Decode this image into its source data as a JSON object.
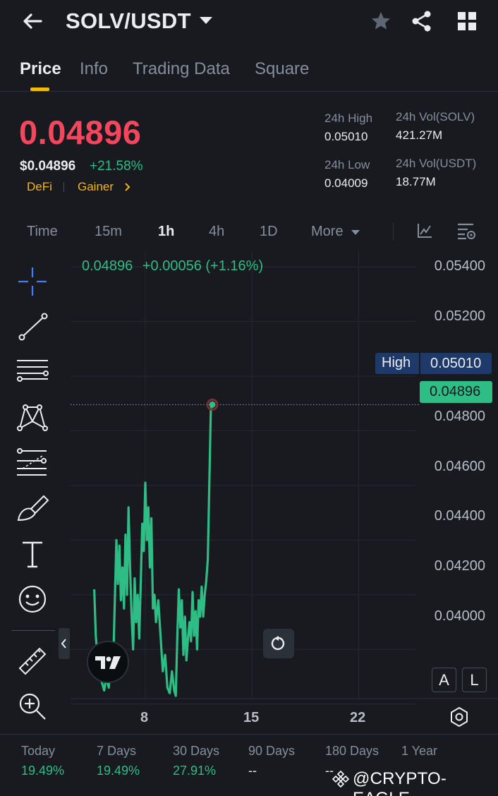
{
  "header": {
    "pair": "SOLV/USDT"
  },
  "tabs": [
    {
      "label": "Price"
    },
    {
      "label": "Info"
    },
    {
      "label": "Trading Data"
    },
    {
      "label": "Square"
    }
  ],
  "ticker": {
    "last_price": "0.04896",
    "usd_price": "$0.04896",
    "change_pct": "+21.58%",
    "tag_category": "DeFi",
    "tag_gainer": "Gainer",
    "high_label": "24h High",
    "high_value": "0.05010",
    "low_label": "24h Low",
    "low_value": "0.04009",
    "vol_base_label": "24h Vol(SOLV)",
    "vol_base_value": "421.27M",
    "vol_quote_label": "24h Vol(USDT)",
    "vol_quote_value": "18.77M"
  },
  "intervals": {
    "time": "Time",
    "m15": "15m",
    "h1": "1h",
    "h4": "4h",
    "d1": "1D",
    "more": "More"
  },
  "chart": {
    "legend_price": "0.04896",
    "legend_change": "+0.00056 (+1.16%)",
    "high_tag_label": "High",
    "high_tag_value": "0.05010",
    "current_tag_value": "0.04896",
    "y_ticks": [
      "0.05400",
      "0.05200",
      "0.04800",
      "0.04600",
      "0.04400",
      "0.04200",
      "0.04000"
    ],
    "x_ticks": [
      "8",
      "15",
      "22"
    ],
    "btn_auto": "A",
    "btn_log": "L",
    "line_color": "#2ebd85",
    "price_color": "#f6465d"
  },
  "chart_data": {
    "type": "line",
    "x_axis": "day of month",
    "y_axis": "price (USDT)",
    "ylim": [
      0.0382,
      0.0546
    ],
    "x_ticks": [
      8,
      15,
      22
    ],
    "series": [
      {
        "points": [
          [
            4.65,
            0.0422
          ],
          [
            4.75,
            0.0405
          ],
          [
            4.85,
            0.0398
          ],
          [
            5.0,
            0.0392
          ],
          [
            5.15,
            0.0388
          ],
          [
            5.3,
            0.0385
          ],
          [
            5.45,
            0.039
          ],
          [
            5.6,
            0.0386
          ],
          [
            5.75,
            0.04
          ],
          [
            5.9,
            0.0396
          ],
          [
            6.0,
            0.0418
          ],
          [
            6.1,
            0.044
          ],
          [
            6.2,
            0.0424
          ],
          [
            6.3,
            0.0438
          ],
          [
            6.4,
            0.0418
          ],
          [
            6.5,
            0.043
          ],
          [
            6.6,
            0.0415
          ],
          [
            6.7,
            0.0442
          ],
          [
            6.8,
            0.042
          ],
          [
            6.9,
            0.0452
          ],
          [
            7.0,
            0.043
          ],
          [
            7.1,
            0.0412
          ],
          [
            7.2,
            0.04
          ],
          [
            7.3,
            0.0426
          ],
          [
            7.4,
            0.041
          ],
          [
            7.5,
            0.042
          ],
          [
            7.6,
            0.0404
          ],
          [
            7.7,
            0.0424
          ],
          [
            7.8,
            0.0446
          ],
          [
            7.9,
            0.0436
          ],
          [
            8.0,
            0.0461
          ],
          [
            8.1,
            0.044
          ],
          [
            8.2,
            0.0452
          ],
          [
            8.3,
            0.043
          ],
          [
            8.4,
            0.0448
          ],
          [
            8.5,
            0.0415
          ],
          [
            8.6,
            0.042
          ],
          [
            8.7,
            0.041
          ],
          [
            8.85,
            0.0418
          ],
          [
            9.0,
            0.0405
          ],
          [
            9.15,
            0.0392
          ],
          [
            9.3,
            0.0398
          ],
          [
            9.45,
            0.0386
          ],
          [
            9.6,
            0.0384
          ],
          [
            9.75,
            0.0392
          ],
          [
            9.9,
            0.0385
          ],
          [
            10.0,
            0.0383
          ],
          [
            10.1,
            0.0405
          ],
          [
            10.2,
            0.0422
          ],
          [
            10.3,
            0.0408
          ],
          [
            10.4,
            0.0418
          ],
          [
            10.5,
            0.0398
          ],
          [
            10.6,
            0.0412
          ],
          [
            10.7,
            0.0396
          ],
          [
            10.8,
            0.0404
          ],
          [
            10.9,
            0.041
          ],
          [
            11.0,
            0.0403
          ],
          [
            11.1,
            0.0421
          ],
          [
            11.2,
            0.0405
          ],
          [
            11.3,
            0.0414
          ],
          [
            11.4,
            0.04
          ],
          [
            11.5,
            0.0418
          ],
          [
            11.6,
            0.0412
          ],
          [
            11.7,
            0.0423
          ],
          [
            11.8,
            0.0412
          ],
          [
            11.9,
            0.042
          ],
          [
            12.0,
            0.0425
          ],
          [
            12.1,
            0.0433
          ],
          [
            12.2,
            0.046
          ],
          [
            12.3,
            0.0488
          ],
          [
            12.4,
            0.04896
          ]
        ]
      }
    ],
    "high_marker": 0.0501,
    "current_marker": 0.04896
  },
  "performance": [
    {
      "label": "Today",
      "value": "19.49%"
    },
    {
      "label": "7 Days",
      "value": "19.49%"
    },
    {
      "label": "30 Days",
      "value": "27.91%"
    },
    {
      "label": "90 Days",
      "value": "--"
    },
    {
      "label": "180 Days",
      "value": "--"
    },
    {
      "label": "1 Year",
      "value": ""
    }
  ],
  "watermark": "@CRYPTO-EAGLE",
  "icons": {
    "back": "back-arrow-icon",
    "dropdown": "caret-down-icon",
    "favorite": "star-icon",
    "share": "share-icon",
    "grid": "grid-icon",
    "tools": [
      "crosshair-icon",
      "trend-line-icon",
      "parallel-lines-icon",
      "pattern-icon",
      "fib-icon",
      "brush-icon",
      "text-icon",
      "emoji-icon",
      "ruler-icon",
      "zoom-in-icon"
    ]
  }
}
